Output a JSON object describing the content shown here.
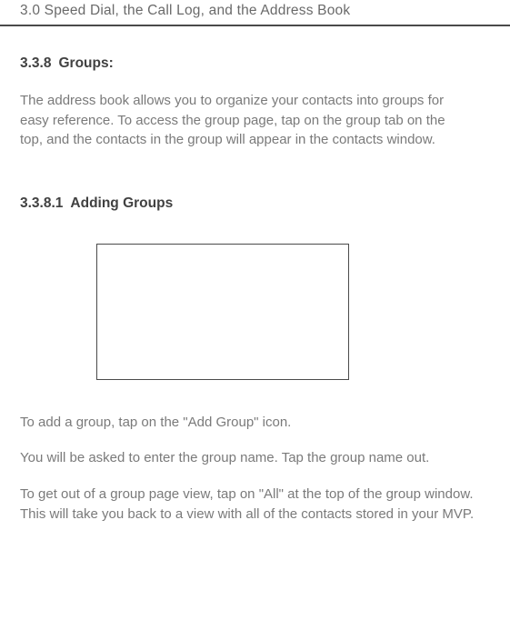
{
  "header": {
    "running_title": "3.0 Speed Dial, the Call Log, and the Address Book"
  },
  "section_338": {
    "number": "3.3.8",
    "title": "Groups:",
    "para": "The address book allows you to organize your contacts into groups for easy reference. To access the group page, tap on the group tab on the top, and the contacts in the group will appear in the contacts window."
  },
  "section_3381": {
    "number": "3.3.8.1",
    "title": "Adding Groups",
    "para1": "To add a group, tap on the \"Add Group\" icon.",
    "para2": "You will be asked to enter the group name. Tap the group name out.",
    "para3": "To get out of a group page view, tap on \"All\" at the top of the group window. This will take you back to a view with all of the contacts stored in your MVP."
  }
}
